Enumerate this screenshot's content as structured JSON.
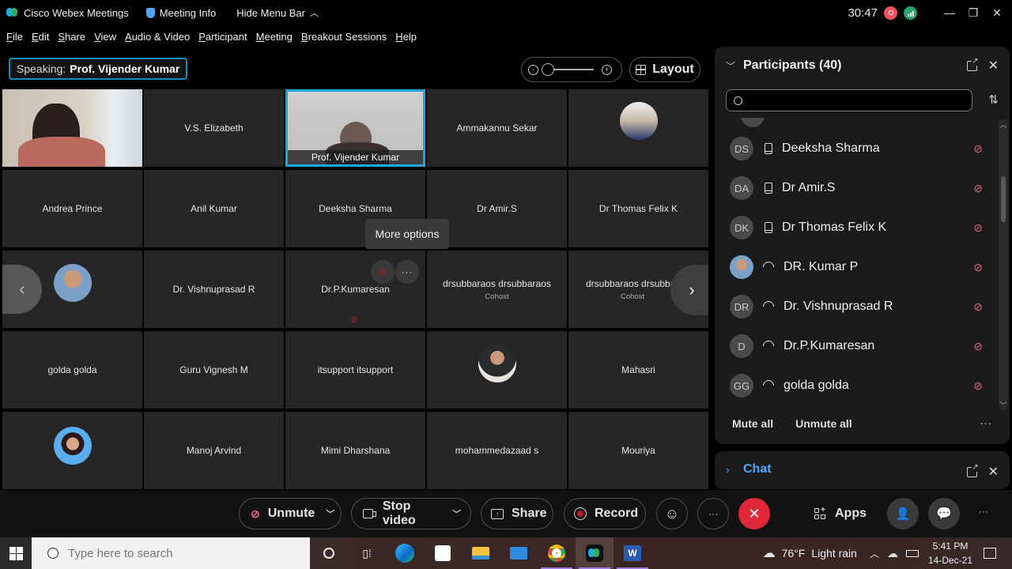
{
  "titlebar": {
    "app_name": "Cisco Webex Meetings",
    "meeting_info": "Meeting Info",
    "hide_menu": "Hide Menu Bar",
    "timer": "30:47",
    "minimize": "—",
    "restore": "❐",
    "close": "✕"
  },
  "menu": [
    {
      "u": "F",
      "rest": "ile"
    },
    {
      "u": "E",
      "rest": "dit"
    },
    {
      "u": "S",
      "rest": "hare"
    },
    {
      "u": "V",
      "rest": "iew"
    },
    {
      "u": "A",
      "rest": "udio & Video"
    },
    {
      "u": "P",
      "rest": "articipant"
    },
    {
      "u": "M",
      "rest": "eeting"
    },
    {
      "u": "B",
      "rest": "reakout Sessions"
    },
    {
      "u": "H",
      "rest": "elp"
    }
  ],
  "speaking": {
    "label": "Speaking:",
    "name": "Prof. Vijender Kumar"
  },
  "layout_label": "Layout",
  "tooltip": "More options",
  "grid": {
    "tiles": [
      {
        "name": "",
        "kind": "video"
      },
      {
        "name": "V.S. Elizabeth",
        "kind": "name"
      },
      {
        "name": "Prof. Vijender Kumar",
        "kind": "speaker"
      },
      {
        "name": "Ammakannu Sekar",
        "kind": "name"
      },
      {
        "name": "",
        "kind": "avatar"
      },
      {
        "name": "Andrea Prince",
        "kind": "name"
      },
      {
        "name": "Anil Kumar",
        "kind": "name"
      },
      {
        "name": "Deeksha Sharma",
        "kind": "name"
      },
      {
        "name": "Dr Amir.S",
        "kind": "name"
      },
      {
        "name": "Dr Thomas Felix K",
        "kind": "name"
      },
      {
        "name": "",
        "kind": "avatar"
      },
      {
        "name": "Dr. Vishnuprasad R",
        "kind": "name"
      },
      {
        "name": "Dr.P.Kumaresan",
        "kind": "hover"
      },
      {
        "name": "drsubbaraos drsubbaraos",
        "kind": "name",
        "sub": "Cohost"
      },
      {
        "name": "drsubbaraos drsubbaraos",
        "kind": "name",
        "sub": "Cohost"
      },
      {
        "name": "golda golda",
        "kind": "name"
      },
      {
        "name": "Guru Vignesh M",
        "kind": "name"
      },
      {
        "name": "itsupport itsupport",
        "kind": "name"
      },
      {
        "name": "",
        "kind": "avatar"
      },
      {
        "name": "Mahasri",
        "kind": "name"
      },
      {
        "name": "",
        "kind": "avatar"
      },
      {
        "name": "Manoj Arvind",
        "kind": "name"
      },
      {
        "name": "Mimi Dharshana",
        "kind": "name"
      },
      {
        "name": "mohammedazaad s",
        "kind": "name"
      },
      {
        "name": "Mouriya",
        "kind": "name"
      }
    ],
    "prev": "‹",
    "next": "›"
  },
  "participants": {
    "title": "Participants (40)",
    "search_placeholder": "",
    "search_value": "",
    "list": [
      {
        "initials": "DS",
        "name": "Deeksha Sharma",
        "device": "phone",
        "muted": true
      },
      {
        "initials": "DA",
        "name": "Dr Amir.S",
        "device": "phone",
        "muted": true
      },
      {
        "initials": "DK",
        "name": "Dr Thomas Felix K",
        "device": "phone",
        "muted": true
      },
      {
        "initials": "",
        "name": "DR. Kumar P",
        "device": "computer-audio",
        "muted": true,
        "photo": true
      },
      {
        "initials": "DR",
        "name": "Dr. Vishnuprasad R",
        "device": "computer-audio",
        "muted": true
      },
      {
        "initials": "D",
        "name": "Dr.P.Kumaresan",
        "device": "computer-audio",
        "muted": true
      },
      {
        "initials": "GG",
        "name": "golda golda",
        "device": "computer-audio",
        "muted": true
      }
    ],
    "mute_all": "Mute all",
    "unmute_all": "Unmute all",
    "more": "···"
  },
  "chat": {
    "title": "Chat"
  },
  "controls": {
    "unmute": "Unmute",
    "stop_video": "Stop video",
    "share": "Share",
    "record": "Record",
    "more": "···",
    "apps": "Apps",
    "overflow": "···"
  },
  "taskbar": {
    "search_placeholder": "Type here to search",
    "weather_temp": "76°F",
    "weather_desc": "Light rain",
    "time": "5:41 PM",
    "date": "14-Dec-21"
  },
  "colors": {
    "accent": "#1aa7e0",
    "leave": "#e0283a",
    "muted_red": "#e8677a",
    "record_red": "#f0535d",
    "network_green": "#23a36a",
    "chat_blue": "#4da6ff"
  }
}
